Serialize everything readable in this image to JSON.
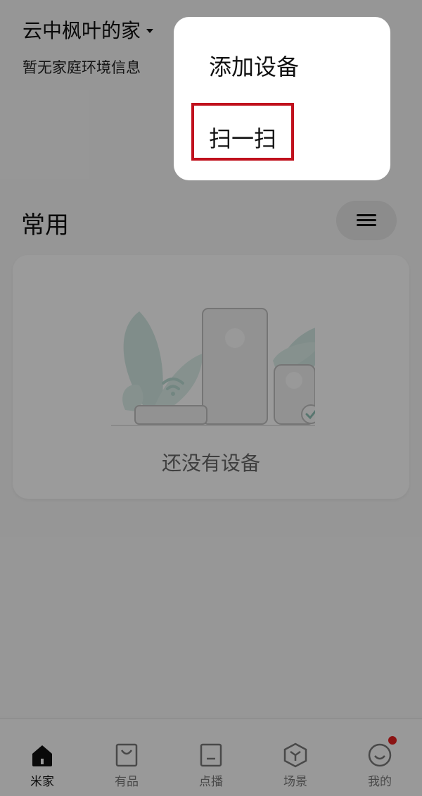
{
  "header": {
    "home_name": "云中枫叶的家",
    "env_info": "暂无家庭环境信息"
  },
  "common": {
    "section_title": "常用",
    "empty_text": "还没有设备"
  },
  "popup_menu": {
    "items": [
      {
        "label": "添加设备"
      },
      {
        "label": "扫一扫"
      }
    ]
  },
  "bottom_nav": {
    "items": [
      {
        "label": "米家",
        "icon": "home-icon",
        "active": true
      },
      {
        "label": "有品",
        "icon": "shopping-bag-icon"
      },
      {
        "label": "点播",
        "icon": "tv-icon"
      },
      {
        "label": "场景",
        "icon": "scene-cube-icon"
      },
      {
        "label": "我的",
        "icon": "smile-profile-icon",
        "badge": true
      }
    ]
  },
  "colors": {
    "highlight": "#c0111d",
    "badge": "#e02020",
    "illustration_leaf": "#cfe4df",
    "illustration_device": "#ececec"
  }
}
